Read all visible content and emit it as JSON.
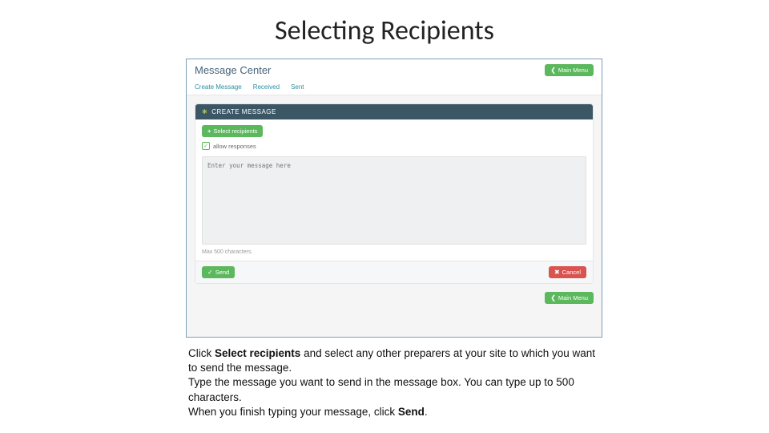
{
  "slide": {
    "title": "Selecting Recipients"
  },
  "app": {
    "page_title": "Message Center",
    "main_menu_label": "Main Menu",
    "tabs": {
      "create": "Create Message",
      "received": "Received",
      "sent": "Sent"
    },
    "panel_title": "CREATE MESSAGE",
    "select_recipients_label": "Select recipients",
    "allow_responses_label": "allow responses",
    "message_placeholder": "Enter your message here",
    "char_limit_note": "Max 500 characters.",
    "send_label": "Send",
    "cancel_label": "Cancel"
  },
  "instructions": {
    "line1_pre": "Click ",
    "line1_bold": "Select recipients",
    "line1_post": " and select any other preparers at your site to which you want to send the message.",
    "line2": "Type the message you want to send in the message box. You can type up to 500 characters.",
    "line3_pre": "When you finish typing your message, click ",
    "line3_bold": "Send",
    "line3_post": "."
  }
}
